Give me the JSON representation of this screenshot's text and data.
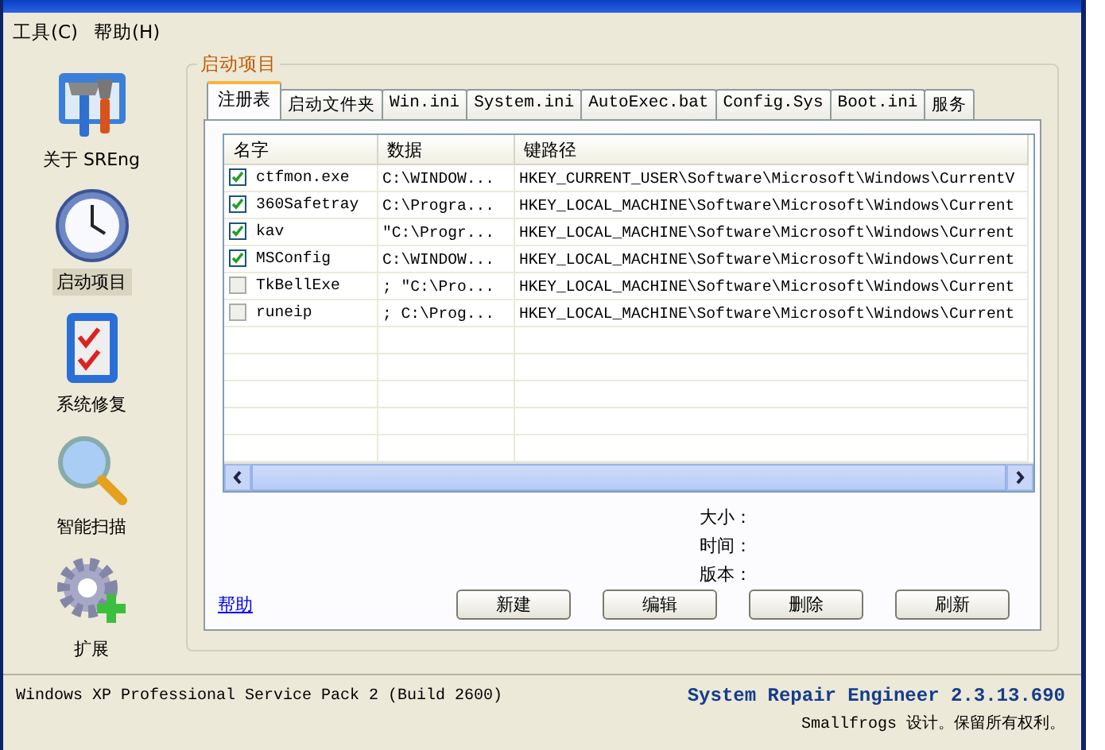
{
  "menu": [
    {
      "label": "工具(C)"
    },
    {
      "label": "帮助(H)"
    }
  ],
  "sidebar": {
    "items": [
      {
        "label": "关于 SREng",
        "kind": "tools",
        "selected": false
      },
      {
        "label": "启动项目",
        "kind": "clock",
        "selected": true
      },
      {
        "label": "系统修复",
        "kind": "checklist",
        "selected": false
      },
      {
        "label": "智能扫描",
        "kind": "magnifier",
        "selected": false
      },
      {
        "label": "扩展",
        "kind": "gear",
        "selected": false
      }
    ]
  },
  "group": {
    "title": "启动项目",
    "tabs": [
      {
        "label": "注册表",
        "selected": true
      },
      {
        "label": "启动文件夹",
        "selected": false
      },
      {
        "label": "Win.ini",
        "selected": false
      },
      {
        "label": "System.ini",
        "selected": false
      },
      {
        "label": "AutoExec.bat",
        "selected": false
      },
      {
        "label": "Config.Sys",
        "selected": false
      },
      {
        "label": "Boot.ini",
        "selected": false
      },
      {
        "label": "服务",
        "selected": false
      }
    ],
    "table": {
      "columns": [
        "名字",
        "数据",
        "键路径"
      ],
      "rows": [
        {
          "checked": true,
          "name": "ctfmon.exe",
          "data": "C:\\WINDOW...",
          "path": "HKEY_CURRENT_USER\\Software\\Microsoft\\Windows\\CurrentV"
        },
        {
          "checked": true,
          "name": "360Safetray",
          "data": "C:\\Progra...",
          "path": "HKEY_LOCAL_MACHINE\\Software\\Microsoft\\Windows\\Current"
        },
        {
          "checked": true,
          "name": "kav",
          "data": "\"C:\\Progr...",
          "path": "HKEY_LOCAL_MACHINE\\Software\\Microsoft\\Windows\\Current"
        },
        {
          "checked": true,
          "name": "MSConfig",
          "data": "C:\\WINDOW...",
          "path": "HKEY_LOCAL_MACHINE\\Software\\Microsoft\\Windows\\Current"
        },
        {
          "checked": false,
          "name": "TkBellExe",
          "data": "; \"C:\\Pro...",
          "path": "HKEY_LOCAL_MACHINE\\Software\\Microsoft\\Windows\\Current"
        },
        {
          "checked": false,
          "name": "runeip",
          "data": "; C:\\Prog...",
          "path": "HKEY_LOCAL_MACHINE\\Software\\Microsoft\\Windows\\Current"
        }
      ]
    },
    "details": [
      "大小：",
      "时间：",
      "版本："
    ],
    "help_link": "帮助",
    "buttons": [
      "新建",
      "编辑",
      "删除",
      "刷新"
    ]
  },
  "status": {
    "os": "Windows XP Professional Service Pack 2 (Build 2600)",
    "product": "System Repair Engineer 2.3.13.690",
    "copyright": "Smallfrogs 设计。保留所有权利。"
  }
}
